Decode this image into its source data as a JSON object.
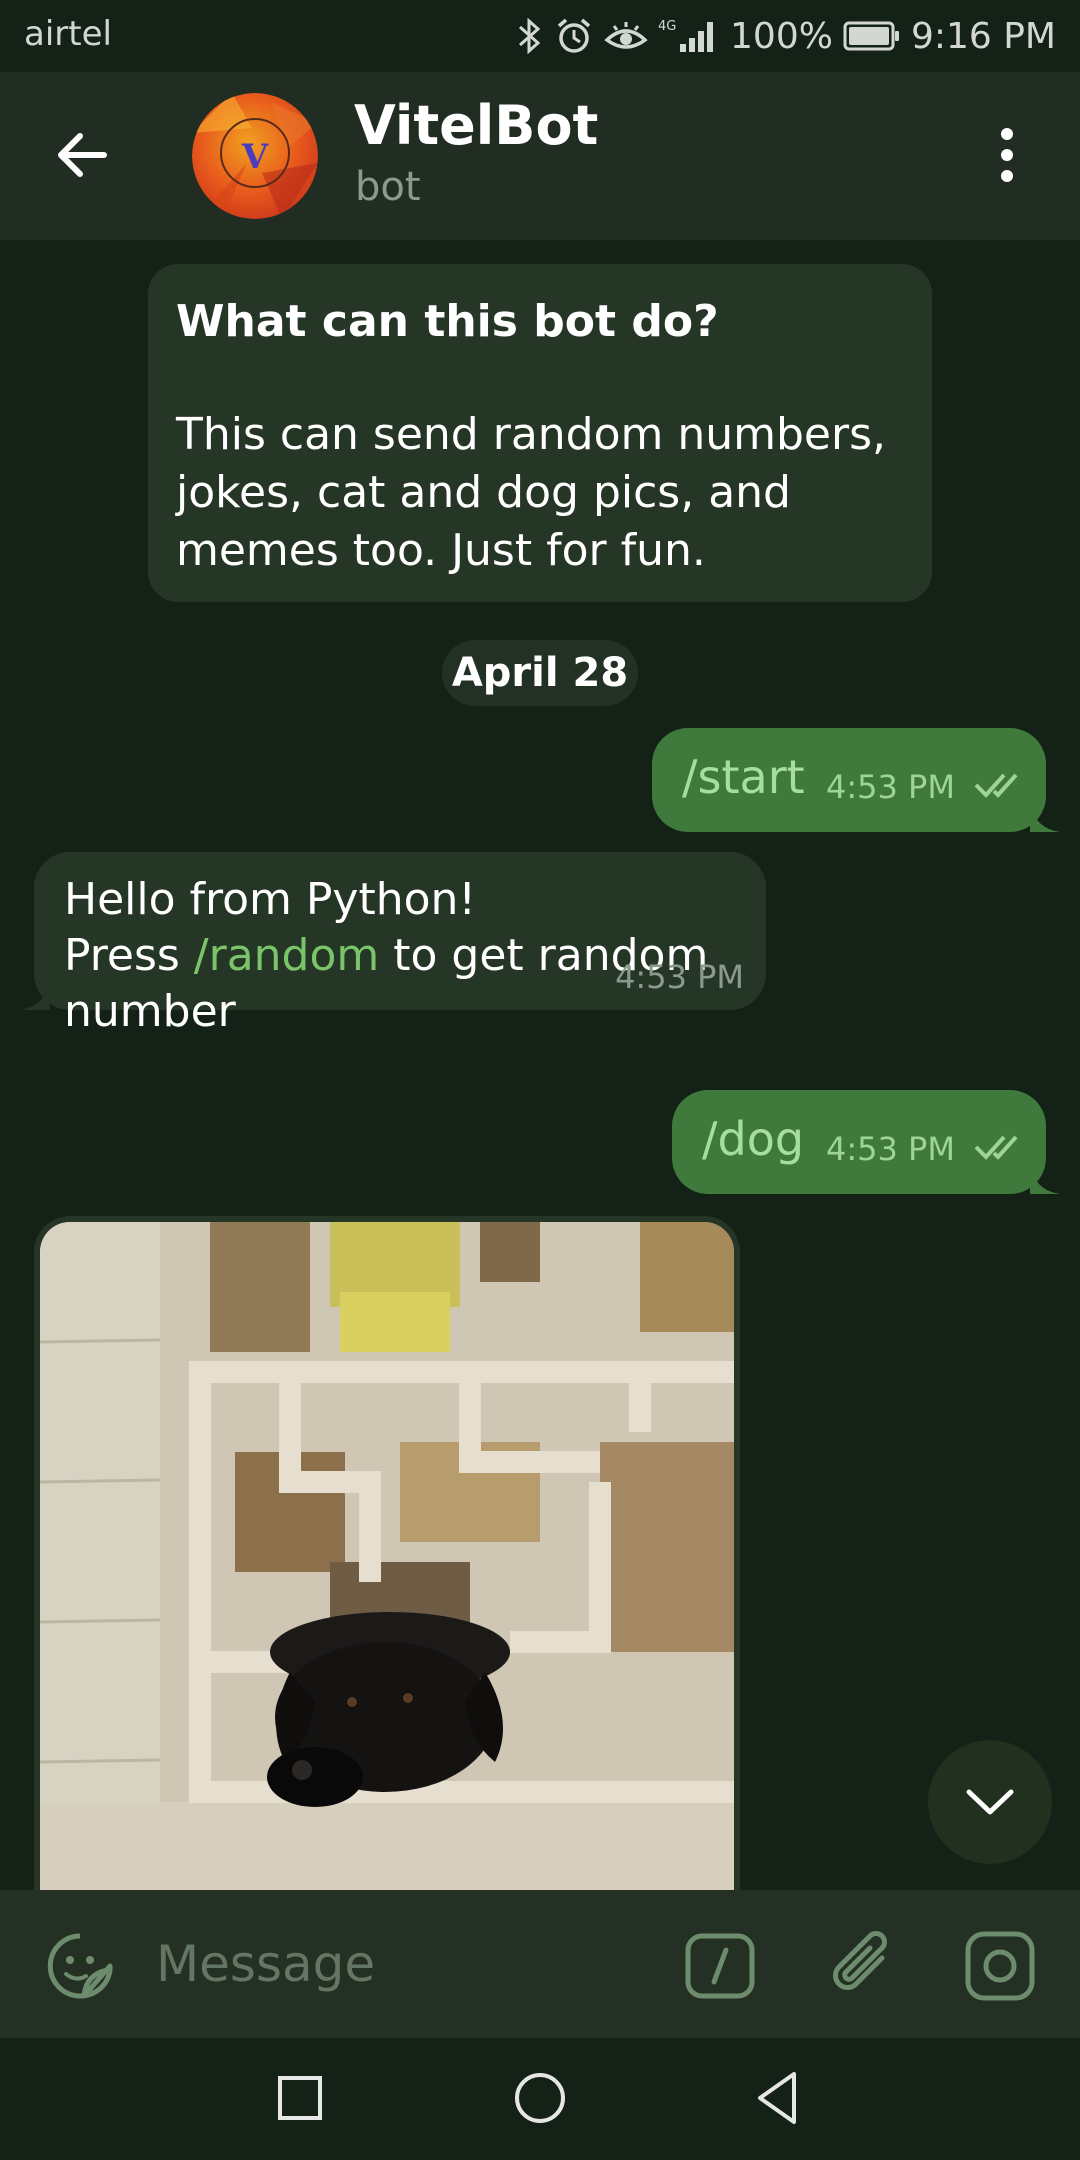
{
  "status_bar": {
    "carrier": "airtel",
    "network": "4G",
    "battery": "100%",
    "time": "9:16 PM"
  },
  "header": {
    "title": "VitelBot",
    "subtitle": "bot",
    "avatar_letter": "V"
  },
  "bot_info": {
    "title": "What can this bot do?",
    "description": "This can send random numbers, jokes, cat and dog pics, and memes too. Just for fun."
  },
  "date_chip": "April 28",
  "messages": [
    {
      "direction": "out",
      "text": "/start",
      "time": "4:53 PM",
      "status": "read"
    },
    {
      "direction": "in",
      "line1": "Hello from Python!",
      "line2_prefix": "Press ",
      "line2_link": "/random",
      "line2_suffix": " to get random",
      "line3": "number",
      "time": "4:53 PM"
    },
    {
      "direction": "out",
      "text": "/dog",
      "time": "4:53 PM",
      "status": "read"
    },
    {
      "direction": "in",
      "type": "photo",
      "subject": "dog looking through decorative wall"
    }
  ],
  "input": {
    "placeholder": "Message"
  },
  "colors": {
    "background": "#132117",
    "header": "#212d22",
    "outgoing_bubble": "#3f7a3c",
    "incoming_bubble": "#263626",
    "accent": "#7ac46a"
  }
}
